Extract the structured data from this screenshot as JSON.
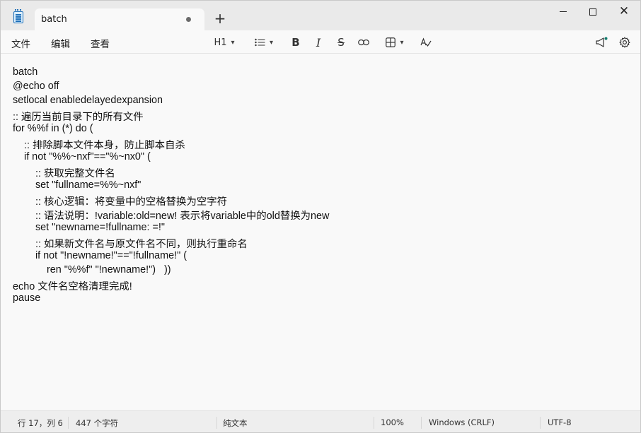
{
  "window": {
    "tab_title": "batch",
    "new_tab": "+",
    "minimize": "",
    "maximize": "",
    "close": "✕"
  },
  "menu": {
    "file": "文件",
    "edit": "编辑",
    "view": "查看"
  },
  "toolbar": {
    "heading": "H1",
    "list_icon": "list-icon",
    "bold": "B",
    "italic": "I",
    "strikethrough": "S",
    "link_icon": "link-icon",
    "table_icon": "table-icon",
    "spellcheck_icon": "spellcheck-icon",
    "copilot_icon": "megaphone-icon",
    "settings_icon": "gear-icon"
  },
  "editor": {
    "lines": [
      "batch",
      "@echo off",
      "setlocal enabledelayedexpansion",
      ":: 遍历当前目录下的所有文件",
      "for %%f in (*) do (",
      "    :: 排除脚本文件本身，防止脚本自杀",
      "    if not \"%%~nxf\"==\"%~nx0\" (",
      "        :: 获取完整文件名",
      "        set \"fullname=%%~nxf\"",
      "        :: 核心逻辑：将变量中的空格替换为空字符",
      "        :: 语法说明：!variable:old=new! 表示将variable中的old替换为new",
      "        set \"newname=!fullname: =!\"",
      "        :: 如果新文件名与原文件名不同，则执行重命名",
      "        if not \"!newname!\"==\"!fullname!\" (",
      "            ren \"%%f\" \"!newname!\")   ))",
      "echo 文件名空格清理完成!",
      "pause"
    ]
  },
  "status": {
    "position": "行 17，列 6",
    "chars": "447 个字符",
    "format": "纯文本",
    "zoom": "100%",
    "line_ending": "Windows (CRLF)",
    "encoding": "UTF-8"
  }
}
